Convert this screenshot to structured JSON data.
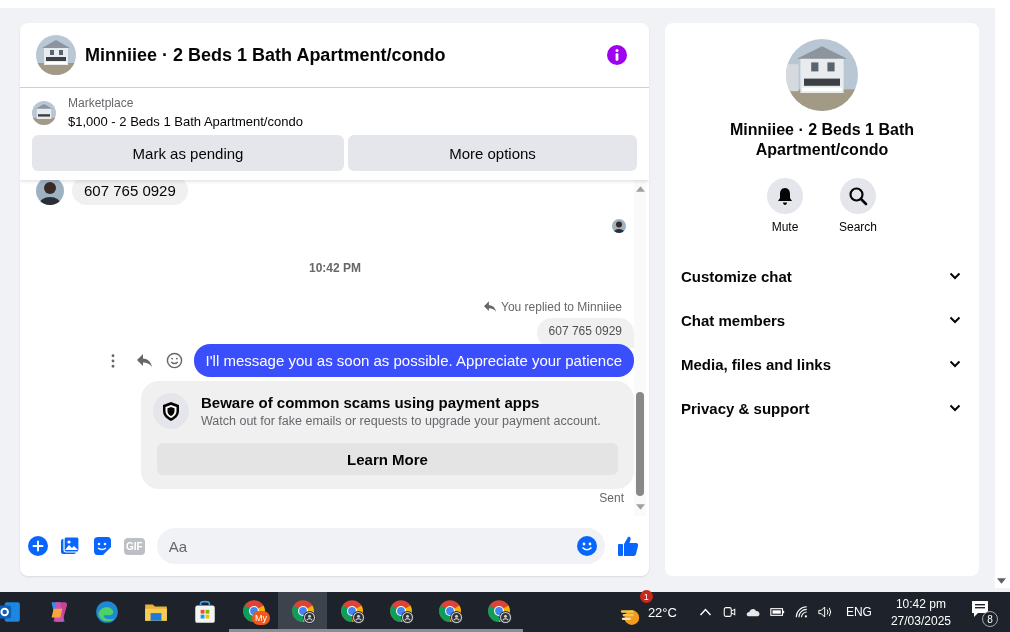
{
  "header": {
    "title": "Minniiee · 2 Beds 1 Bath Apartment/condo"
  },
  "listing": {
    "source": "Marketplace",
    "title": "$1,000 - 2 Beds 1 Bath Apartment/condo",
    "actions": [
      "Mark as pending",
      "More options"
    ]
  },
  "messages": [
    {
      "kind": "incoming",
      "text": "607 765 0929"
    },
    {
      "kind": "seen"
    },
    {
      "kind": "time",
      "text": "10:42 PM"
    },
    {
      "kind": "reply_note",
      "text": "You replied to Minniiee"
    },
    {
      "kind": "quoted",
      "text": "607 765 0929"
    },
    {
      "kind": "outgoing",
      "text": "I'll message you as soon as possible. Appreciate your patience"
    },
    {
      "kind": "notice",
      "title": "Beware of common scams using payment apps",
      "body": "Watch out for fake emails or requests to upgrade your payment account.",
      "button": "Learn More"
    },
    {
      "kind": "status",
      "text": "Sent"
    }
  ],
  "composer": {
    "gif_label": "GIF",
    "placeholder": "Aa"
  },
  "details": {
    "title": "Minniiee · 2 Beds 1 Bath Apartment/condo",
    "actions": [
      {
        "kind": "mute",
        "label": "Mute"
      },
      {
        "kind": "search",
        "label": "Search"
      }
    ],
    "sections": [
      {
        "label": "Customize chat",
        "expanded": false
      },
      {
        "label": "Chat members",
        "expanded": false
      },
      {
        "label": "Media, files and links",
        "expanded": false
      },
      {
        "label": "Privacy & support",
        "expanded": false
      }
    ]
  },
  "taskbar": {
    "apps": [
      {
        "kind": "outlook",
        "selected": false
      },
      {
        "kind": "copilot",
        "selected": false
      },
      {
        "kind": "edge",
        "selected": false
      },
      {
        "kind": "folder",
        "selected": false
      },
      {
        "kind": "store",
        "selected": false
      },
      {
        "kind": "chrome",
        "badge": "My",
        "selected": false
      },
      {
        "kind": "chrome",
        "selected": true
      },
      {
        "kind": "chrome",
        "selected": false
      },
      {
        "kind": "chrome",
        "selected": false
      },
      {
        "kind": "chrome",
        "selected": false
      },
      {
        "kind": "chrome",
        "selected": false
      }
    ],
    "weather": {
      "badge": "1",
      "temperature": "22°C"
    },
    "language": "ENG",
    "time": "10:42 pm",
    "date": "27/03/2025",
    "notifications": "8"
  }
}
